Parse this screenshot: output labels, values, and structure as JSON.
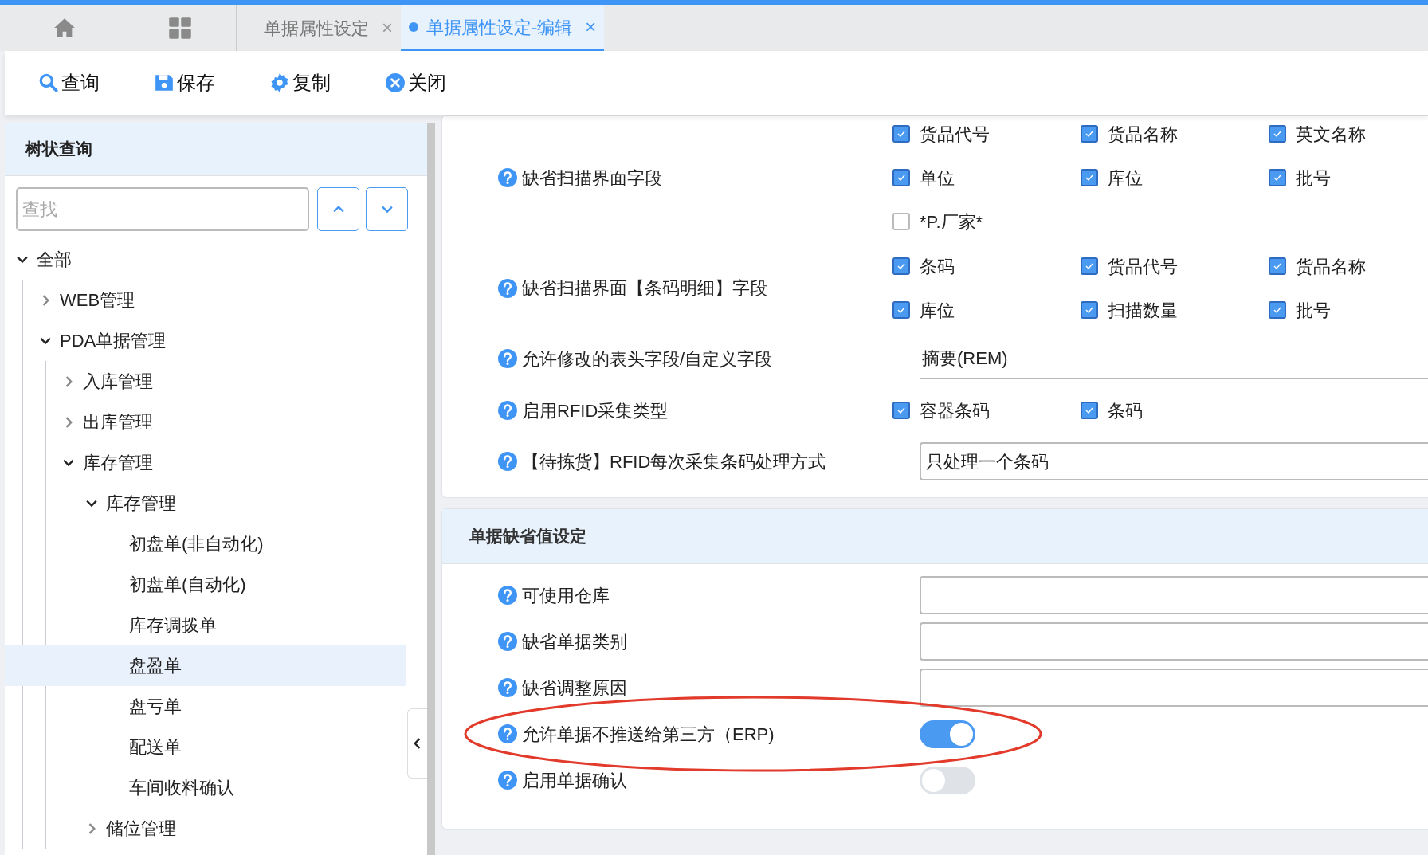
{
  "tabs": [
    {
      "label": "单据属性设定",
      "selected": false,
      "close": "×"
    },
    {
      "label": "单据属性设定-编辑",
      "selected": true,
      "close": "×"
    }
  ],
  "toolbar": [
    {
      "label": "查询",
      "kind": "search"
    },
    {
      "label": "保存",
      "kind": "save"
    },
    {
      "label": "复制",
      "kind": "gear"
    },
    {
      "label": "关闭",
      "kind": "close"
    }
  ],
  "sidebar": {
    "title": "树状查询",
    "search": {
      "placeholder": "查找"
    },
    "tree": [
      {
        "label": "全部",
        "expanded": true,
        "children": [
          {
            "label": "WEB管理",
            "expanded": false,
            "selected": false
          },
          {
            "label": "PDA单据管理",
            "expanded": true,
            "selected": false,
            "children": [
              {
                "label": "入库管理",
                "expanded": false,
                "selected": false
              },
              {
                "label": "出库管理",
                "expanded": false,
                "selected": false
              },
              {
                "label": "库存管理",
                "expanded": true,
                "selected": false,
                "children": [
                  {
                    "label": "库存管理",
                    "expanded": true,
                    "selected": false,
                    "children": [
                      {
                        "label": "初盘单(非自动化)",
                        "selected": false
                      },
                      {
                        "label": "初盘单(自动化)",
                        "selected": false
                      },
                      {
                        "label": "库存调拨单",
                        "selected": false
                      },
                      {
                        "label": "盘盈单",
                        "selected": true
                      },
                      {
                        "label": "盘亏单",
                        "selected": false
                      },
                      {
                        "label": "配送单",
                        "selected": false
                      },
                      {
                        "label": "车间收料确认",
                        "selected": false
                      }
                    ]
                  },
                  {
                    "label": "储位管理",
                    "expanded": false,
                    "selected": false
                  }
                ]
              }
            ]
          }
        ],
        "selected": false
      }
    ]
  },
  "sections": [
    {
      "rows": [
        {
          "kind": "checkboxes",
          "label": "缺省扫描界面字段",
          "options": [
            {
              "label": "货品代号",
              "checked": true
            },
            {
              "label": "货品名称",
              "checked": true
            },
            {
              "label": "英文名称",
              "checked": true
            },
            {
              "label": "单位",
              "checked": true
            },
            {
              "label": "库位",
              "checked": true
            },
            {
              "label": "批号",
              "checked": true
            },
            {
              "label": "*P.厂家*",
              "checked": false
            }
          ]
        },
        {
          "kind": "checkboxes",
          "label": "缺省扫描界面【条码明细】字段",
          "options": [
            {
              "label": "条码",
              "checked": true
            },
            {
              "label": "货品代号",
              "checked": true
            },
            {
              "label": "货品名称",
              "checked": true
            },
            {
              "label": "库位",
              "checked": true
            },
            {
              "label": "扫描数量",
              "checked": true
            },
            {
              "label": "批号",
              "checked": true
            }
          ]
        },
        {
          "kind": "text",
          "label": "允许修改的表头字段/自定义字段",
          "value": "摘要(REM)"
        },
        {
          "kind": "checkboxes",
          "label": "启用RFID采集类型",
          "options": [
            {
              "label": "容器条码",
              "checked": true
            },
            {
              "label": "条码",
              "checked": true
            }
          ]
        },
        {
          "kind": "select",
          "label": "【待拣货】RFID每次采集条码处理方式",
          "value": "只处理一个条码"
        }
      ]
    },
    {
      "title": "单据缺省值设定",
      "rows": [
        {
          "kind": "input",
          "label": "可使用仓库"
        },
        {
          "kind": "input",
          "label": "缺省单据类别"
        },
        {
          "kind": "input",
          "label": "缺省调整原因"
        },
        {
          "kind": "switch",
          "label": "允许单据不推送给第三方（ERP)",
          "on": true,
          "highlighted": true
        },
        {
          "kind": "switch",
          "label": "启用单据确认",
          "on": false,
          "highlighted": false
        }
      ]
    }
  ]
}
